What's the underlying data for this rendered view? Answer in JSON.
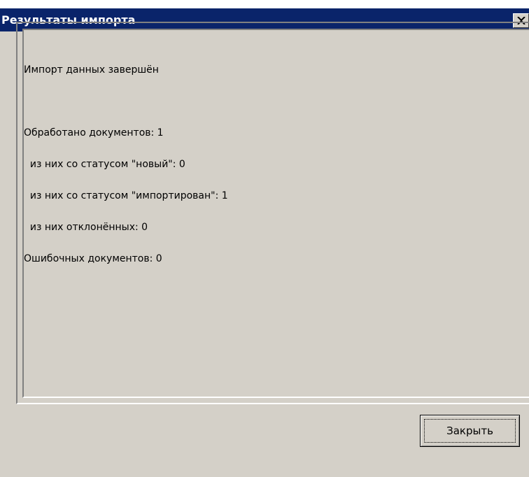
{
  "window": {
    "title": "Результаты импорта",
    "close_glyph": "×",
    "close_icon": "close-icon",
    "title_bar_color": "#0a246a",
    "face_color": "#d4d0c8"
  },
  "report": {
    "lines": [
      "Импорт данных завершён",
      "",
      "Обработано документов: 1",
      "  из них со статусом \"новый\": 0",
      "  из них со статусом \"импортирован\": 1",
      "  из них отклонённых: 0",
      "Ошибочных документов: 0"
    ]
  },
  "buttons": {
    "close_label": "Закрыть"
  }
}
